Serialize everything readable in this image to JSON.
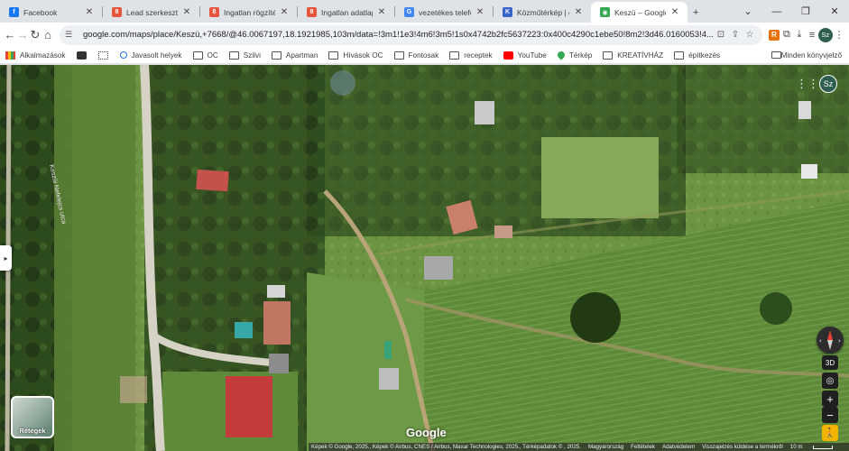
{
  "tabs": [
    {
      "title": "Facebook",
      "icon": "facebook-icon",
      "color": "#1877f2",
      "glyph": "f",
      "active": false
    },
    {
      "title": "Lead szerkesztése | I",
      "icon": "ingatlan-icon",
      "color": "#e8553e",
      "glyph": "8",
      "active": false
    },
    {
      "title": "Ingatlan rögzítése | I",
      "icon": "ingatlan-icon",
      "color": "#e8553e",
      "glyph": "8",
      "active": false
    },
    {
      "title": "Ingatlan adatlap | H",
      "icon": "ingatlan-icon",
      "color": "#e8553e",
      "glyph": "8",
      "active": false
    },
    {
      "title": "vezetékes telefon tu",
      "icon": "google-icon",
      "color": "#4285f4",
      "glyph": "G",
      "active": false
    },
    {
      "title": "Közműtérkép | e-köz",
      "icon": "kozmu-icon",
      "color": "#3a64c8",
      "glyph": "K",
      "active": false
    },
    {
      "title": "Keszü – Google Térk",
      "icon": "google-maps-icon",
      "color": "#34a853",
      "glyph": "◉",
      "active": true
    }
  ],
  "toolbar": {
    "url": "google.com/maps/place/Keszü,+7668/@46.0067197,18.1921985,103m/data=!3m1!1e3!4m6!3m5!1s0x4742b2fc5637223:0x400c4290c1ebe50!8m2!3d46.0160053!4...",
    "profile_initials": "Sz",
    "ext_label": "R"
  },
  "bookmarks": [
    {
      "label": "Alkalmazások",
      "icon": "apps-grid-icon"
    },
    {
      "label": "",
      "icon": "app-black-square-icon"
    },
    {
      "label": "",
      "icon": "app-grid-icon"
    },
    {
      "label": "Javasolt helyek",
      "icon": "search-icon"
    },
    {
      "label": "OC",
      "icon": "folder-icon"
    },
    {
      "label": "Szilvi",
      "icon": "folder-icon"
    },
    {
      "label": "Apartman",
      "icon": "folder-icon"
    },
    {
      "label": "Hívások OC",
      "icon": "folder-icon"
    },
    {
      "label": "Fontosak",
      "icon": "folder-icon"
    },
    {
      "label": "receptek",
      "icon": "folder-icon"
    },
    {
      "label": "YouTube",
      "icon": "youtube-icon"
    },
    {
      "label": "Térkép",
      "icon": "maps-pin-icon"
    },
    {
      "label": "KREATÍVHÁZ",
      "icon": "folder-icon"
    },
    {
      "label": "építkezés",
      "icon": "folder-icon"
    }
  ],
  "bookmarks_right": "Minden könyvjelző",
  "map": {
    "street_label": "Keszüi Nefelejcs utca",
    "avatar": "Sz",
    "layers_label": "Rétegek",
    "btn_3d": "3D",
    "zoom_in": "+",
    "zoom_out": "−",
    "google_logo": "Google",
    "attribution": "Képek © Google, 2025., Képek © Airbus, CNES / Airbus, Maxar Technologies, 2025., Térképadatok © , 2025.",
    "links": [
      "Magyarország",
      "Feltételek",
      "Adatvédelem",
      "Visszajelzés küldése a termékről"
    ],
    "scale": "10 m"
  }
}
